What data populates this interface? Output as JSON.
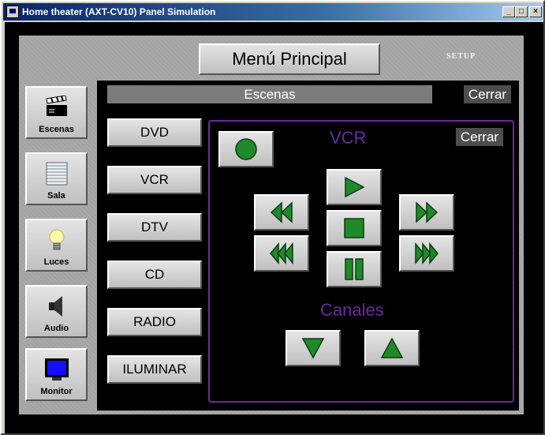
{
  "window": {
    "title": "Home theater (AXT-CV10) Panel Simulation",
    "controls": [
      "minimize",
      "maximize",
      "close"
    ]
  },
  "header": {
    "menu_title": "Menú Principal",
    "setup_label": "SETUP"
  },
  "sidebar": {
    "items": [
      {
        "label": "Escenas",
        "icon": "clapperboard-icon"
      },
      {
        "label": "Sala",
        "icon": "window-blinds-icon"
      },
      {
        "label": "Luces",
        "icon": "lightbulb-icon"
      },
      {
        "label": "Audio",
        "icon": "speaker-icon"
      },
      {
        "label": "Monitor",
        "icon": "monitor-icon"
      }
    ]
  },
  "scenes_bar": {
    "title": "Escenas",
    "close_label": "Cerrar"
  },
  "sources": {
    "items": [
      "DVD",
      "VCR",
      "DTV",
      "CD",
      "RADIO",
      "ILUMINAR"
    ]
  },
  "vcr_panel": {
    "title": "VCR",
    "close_label": "Cerrar",
    "channels_label": "Canales",
    "controls": [
      "record",
      "play",
      "rewind",
      "fast-forward",
      "stop",
      "skip-back",
      "skip-forward",
      "pause",
      "channel-down",
      "channel-up"
    ]
  },
  "colors": {
    "accent_purple": "#6a2aa0",
    "icon_green": "#1f8a2a",
    "panel_gray": "#a6a6a6",
    "title_bar": "#0a246a"
  }
}
